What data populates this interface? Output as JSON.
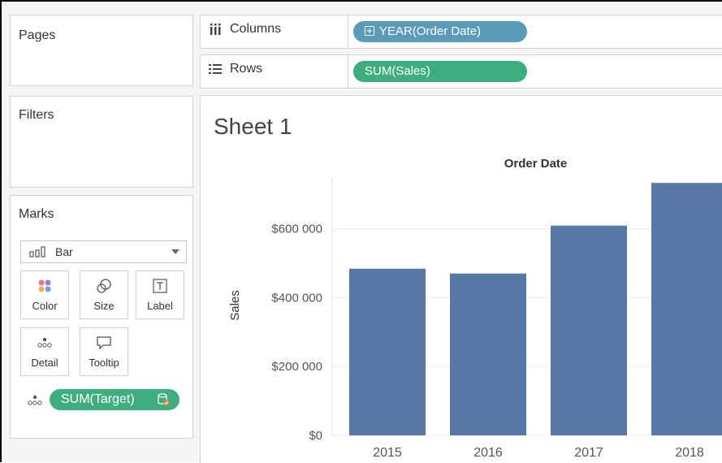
{
  "panels": {
    "pages": "Pages",
    "filters": "Filters",
    "marks": "Marks"
  },
  "shelves": {
    "columns": {
      "label": "Columns",
      "pill": "YEAR(Order Date)"
    },
    "rows": {
      "label": "Rows",
      "pill": "SUM(Sales)"
    }
  },
  "marks": {
    "type": "Bar",
    "buttons": {
      "color": "Color",
      "size": "Size",
      "label": "Label",
      "detail": "Detail",
      "tooltip": "Tooltip"
    },
    "detail_pill": "SUM(Target)"
  },
  "sheet": {
    "title": "Sheet 1"
  },
  "colors": {
    "bar": "#5778a4",
    "pill_blue": "#5b9bba",
    "pill_green": "#3fae7f"
  },
  "chart_data": {
    "type": "bar",
    "header": "Order Date",
    "categories": [
      "2015",
      "2016",
      "2017",
      "2018"
    ],
    "values": [
      484000,
      470000,
      609000,
      733000
    ],
    "ylabel": "Sales",
    "yticks": [
      "$0",
      "$200 000",
      "$400 000",
      "$600 000"
    ],
    "ytick_values": [
      0,
      200000,
      400000,
      600000
    ],
    "ylim": [
      0,
      750000
    ],
    "grid": true
  }
}
